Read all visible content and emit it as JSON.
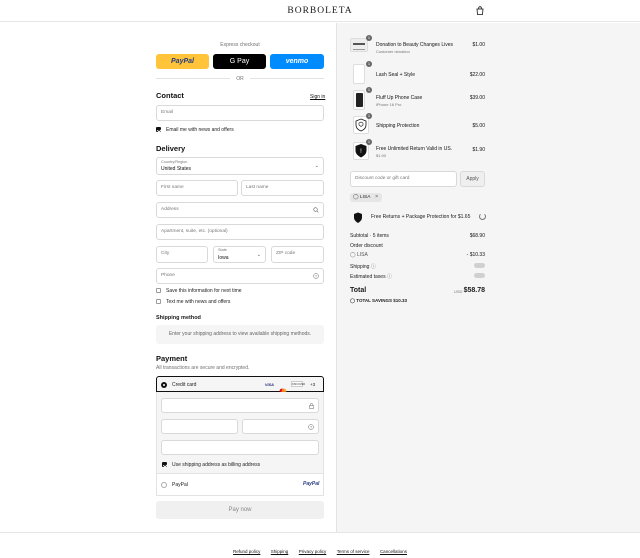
{
  "header": {
    "brand": "BORBOLETA"
  },
  "express": {
    "title": "Express checkout",
    "paypal": "PayPal",
    "gpay": "G Pay",
    "venmo": "venmo",
    "or": "OR"
  },
  "contact": {
    "heading": "Contact",
    "sign_in": "Sign in",
    "email_placeholder": "Email",
    "news_label": "Email me with news and offers"
  },
  "delivery": {
    "heading": "Delivery",
    "country_label": "Country/Region",
    "country_value": "United States",
    "first_name": "First name",
    "last_name": "Last name",
    "address": "Address",
    "apartment": "Apartment, suite, etc. (optional)",
    "city": "City",
    "state_label": "State",
    "state_value": "Iowa",
    "zip": "ZIP code",
    "phone": "Phone",
    "save_info": "Save this information for next time",
    "text_me": "Text me with news and offers"
  },
  "shipping": {
    "heading": "Shipping method",
    "note": "Enter your shipping address to view available shipping methods."
  },
  "payment": {
    "heading": "Payment",
    "subtitle": "All transactions are secure and encrypted.",
    "credit_card": "Credit card",
    "card_brands": [
      "VISA",
      "MC",
      "DISCOVER"
    ],
    "more": "+3",
    "billing_label": "Use shipping address as billing address",
    "paypal": "PayPal",
    "paypal_logo": "PayPal",
    "pay_now": "Pay now"
  },
  "cart": {
    "items": [
      {
        "name": "Donation to Beauty Changes Lives",
        "sub": "Customer donation",
        "price": "$1.00",
        "qty": "1"
      },
      {
        "name": "Lash Seal + Style",
        "sub": "",
        "price": "$22.00",
        "qty": "1"
      },
      {
        "name": "Fluff Up Phone Case",
        "sub": "iPhone 16 Pro",
        "price": "$39.00",
        "qty": "1"
      },
      {
        "name": "Shipping Protection",
        "sub": "",
        "price": "$5.00",
        "qty": "1"
      },
      {
        "name": "Free Unlimited Return Valid in US.",
        "sub": "$1.90",
        "price": "$1.90",
        "qty": "1"
      }
    ],
    "discount_placeholder": "Discount code or gift card",
    "apply": "Apply",
    "code_tag": "LISA",
    "protection_offer": "Free Returns + Package Protection for $1.65",
    "subtotal_label": "Subtotal · 5 items",
    "subtotal_value": "$68.90",
    "order_discount_label": "Order discount",
    "code_label": "LISA",
    "discount_value": "- $10.33",
    "shipping_label": "Shipping",
    "taxes_label": "Estimated taxes",
    "total_label": "Total",
    "currency": "USD",
    "total_value": "$58.78",
    "savings_label": "TOTAL SAVINGS",
    "savings_value": "$10.33"
  },
  "footer": {
    "links": [
      "Refund policy",
      "Shipping",
      "Privacy policy",
      "Terms of service",
      "Cancellations"
    ]
  },
  "colors": {
    "paypal": "#ffc439",
    "venmo": "#008cff",
    "gpay": "#000000"
  }
}
